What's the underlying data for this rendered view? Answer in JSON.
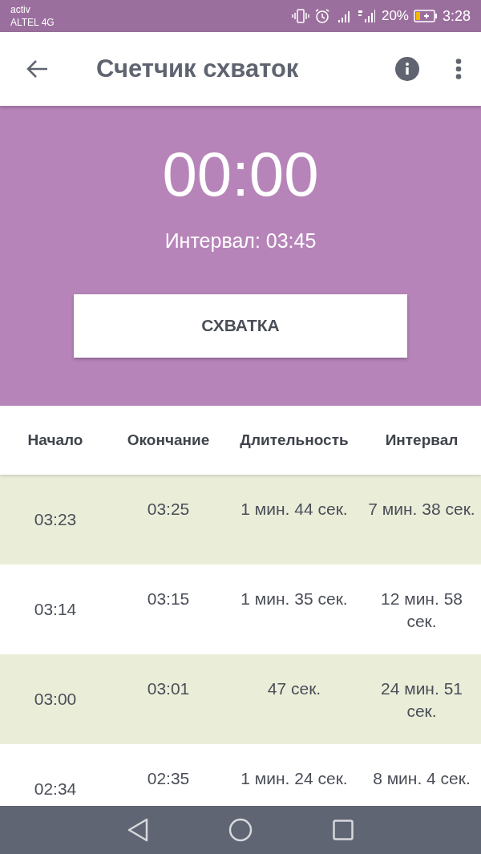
{
  "status_bar": {
    "carrier": "activ",
    "network": "ALTEL 4G",
    "battery": "20%",
    "time": "3:28"
  },
  "app_bar": {
    "title": "Счетчик схваток"
  },
  "timer": {
    "elapsed": "00:00",
    "interval": "Интервал: 03:45",
    "button": "СХВАТКА"
  },
  "table": {
    "columns": [
      "Начало",
      "Окончание",
      "Длительность",
      "Интервал"
    ],
    "rows": [
      {
        "start": "03:23",
        "end": "03:25",
        "duration": "1 мин. 44 сек.",
        "interval": "7 мин. 38 сек."
      },
      {
        "start": "03:14",
        "end": "03:15",
        "duration": "1 мин. 35 сек.",
        "interval": "12 мин. 58 сек."
      },
      {
        "start": "03:00",
        "end": "03:01",
        "duration": "47 сек.",
        "interval": "24 мин. 51 сек."
      },
      {
        "start": "02:34",
        "end": "02:35",
        "duration": "1 мин. 24 сек.",
        "interval": "8 мин. 4 сек."
      }
    ]
  }
}
